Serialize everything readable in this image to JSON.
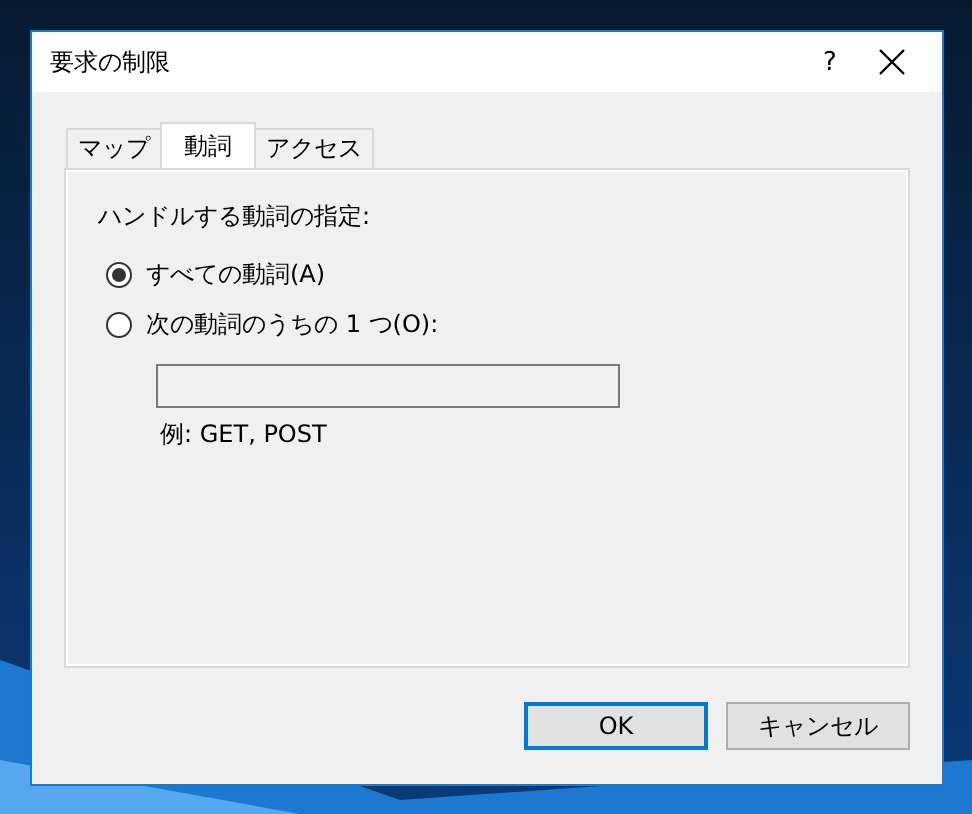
{
  "window": {
    "title": "要求の制限",
    "help": "?"
  },
  "tabs": [
    {
      "label": "マップ",
      "selected": false
    },
    {
      "label": "動詞",
      "selected": true
    },
    {
      "label": "アクセス",
      "selected": false
    }
  ],
  "group_label": "ハンドルする動詞の指定:",
  "options": [
    {
      "label": "すべての動詞(A)",
      "selected": true
    },
    {
      "label": "次の動詞のうちの 1 つ(O):",
      "selected": false
    }
  ],
  "hint": "例: GET, POST",
  "buttons": [
    {
      "label": "OK",
      "default": true
    },
    {
      "label": "キャンセル",
      "default": false
    }
  ]
}
